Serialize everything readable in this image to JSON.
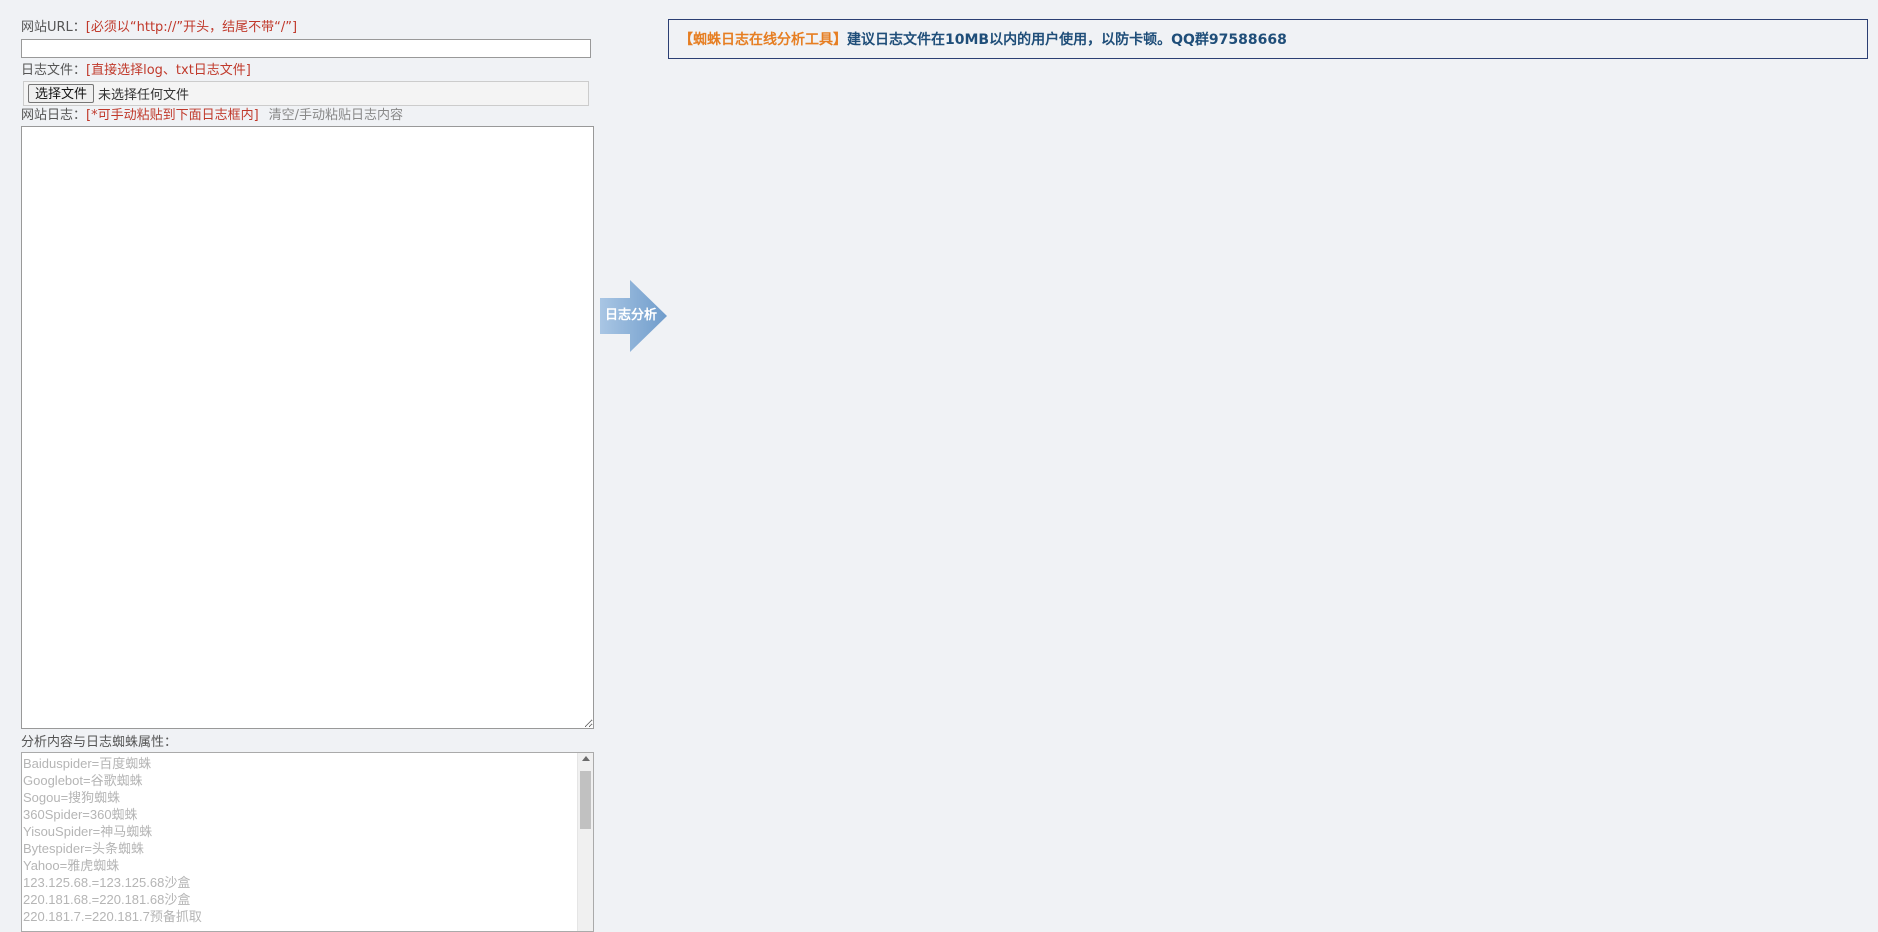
{
  "form": {
    "url_label": "网站URL：",
    "url_hint": "[必须以“http://”开头，结尾不带“/”]",
    "url_value": "",
    "file_label": "日志文件：",
    "file_hint": "[直接选择log、txt日志文件]",
    "file_button": "选择文件",
    "file_status": "未选择任何文件",
    "log_label": "网站日志：",
    "log_hint": "[*可手动粘贴到下面日志框内]",
    "log_clear_action": "清空/手动粘贴日志内容",
    "log_value": "",
    "spider_label": "分析内容与日志蜘蛛属性："
  },
  "spider_list": [
    "Baiduspider=百度蜘蛛",
    "Googlebot=谷歌蜘蛛",
    "Sogou=搜狗蜘蛛",
    "360Spider=360蜘蛛",
    "YisouSpider=神马蜘蛛",
    "Bytespider=头条蜘蛛",
    "Yahoo=雅虎蜘蛛",
    "123.125.68.=123.125.68沙盒",
    "220.181.68.=220.181.68沙盒",
    "220.181.7.=220.181.7预备抓取"
  ],
  "analyze_button": "日志分析",
  "notice": {
    "brand": "【蜘蛛日志在线分析工具】",
    "message": "建议日志文件在10MB以内的用户使用，以防卡顿。QQ群97588668"
  },
  "colors": {
    "hint": "#c0392b",
    "brand": "#e67e22",
    "message": "#1f4e79",
    "arrow": "#7ea9d1",
    "notice_border": "#2b3f73"
  }
}
